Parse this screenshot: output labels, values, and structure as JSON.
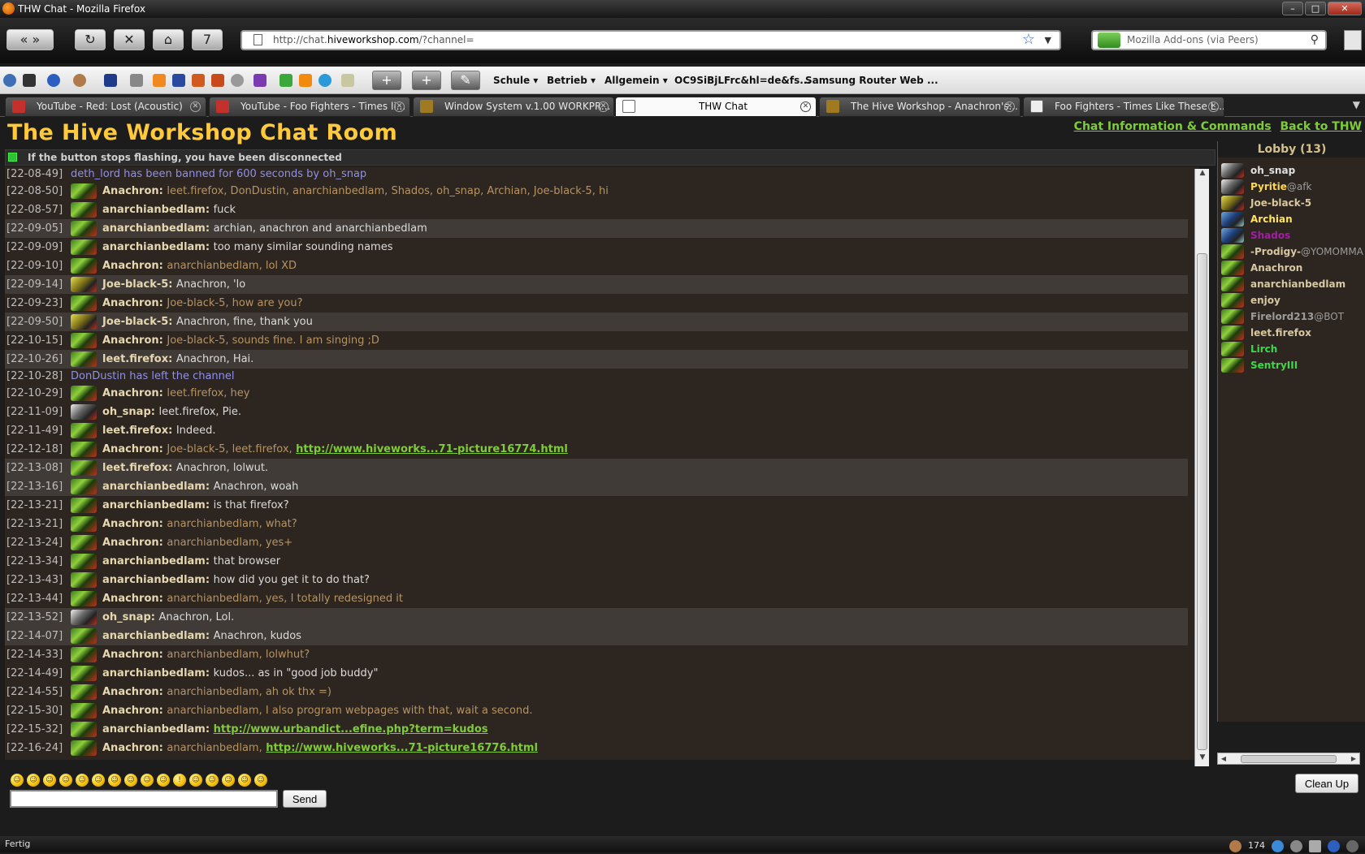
{
  "window": {
    "title": "THW Chat - Mozilla Firefox"
  },
  "nav": {
    "url_prefix": "http://chat.",
    "url_domain": "hiveworkshop.com",
    "url_suffix": "/?channel=",
    "search_placeholder": "Mozilla Add-ons (via Peers)",
    "history_count": "7"
  },
  "bookmarks": {
    "folders": [
      "Schule",
      "Betrieb",
      "Allgemein"
    ],
    "links": [
      "OC9SiBjLFrc&hl=de&fs...",
      "Samsung Router Web ..."
    ]
  },
  "tabs": [
    {
      "label": "YouTube - Red: Lost (Acoustic)",
      "icon": "youtube-icon"
    },
    {
      "label": "YouTube - Foo Fighters - Times li...",
      "icon": "youtube-icon"
    },
    {
      "label": "Window System v.1.00 WORKPR...",
      "icon": "hive-icon"
    },
    {
      "label": "THW Chat",
      "icon": "page-icon"
    },
    {
      "label": "The Hive Workshop - Anachron's...",
      "icon": "hive-icon"
    },
    {
      "label": "Foo Fighters - Times Like These L...",
      "icon": "page-icon"
    }
  ],
  "page": {
    "title": "The Hive Workshop Chat Room",
    "link_info": "Chat Information & Commands",
    "link_back": "Back to THW",
    "status_notice": "If the button stops flashing, you have been disconnected"
  },
  "messages": [
    {
      "ts": "[22-08-49]",
      "system": "deth_lord has been banned for 600 seconds by oh_snap"
    },
    {
      "ts": "[22-08-50]",
      "nick": "Anachron:",
      "text": "leet.firefox, DonDustin, anarchianbedlam, Shados, oh_snap, Archian, Joe-black-5, hi"
    },
    {
      "ts": "[22-08-57]",
      "nick": "anarchianbedlam:",
      "text": "fuck"
    },
    {
      "ts": "[22-09-05]",
      "nick": "anarchianbedlam:",
      "text": "archian, anachron and anarchianbedlam"
    },
    {
      "ts": "[22-09-09]",
      "nick": "anarchianbedlam:",
      "text": "too many similar sounding names"
    },
    {
      "ts": "[22-09-10]",
      "nick": "Anachron:",
      "text": "anarchianbedlam, lol XD"
    },
    {
      "ts": "[22-09-14]",
      "nick": "Joe-black-5:",
      "text": "Anachron, 'lo"
    },
    {
      "ts": "[22-09-23]",
      "nick": "Anachron:",
      "text": "Joe-black-5, how are you?"
    },
    {
      "ts": "[22-09-50]",
      "nick": "Joe-black-5:",
      "text": "Anachron, fine, thank you"
    },
    {
      "ts": "[22-10-15]",
      "nick": "Anachron:",
      "text": "Joe-black-5, sounds fine. I am singing ;D"
    },
    {
      "ts": "[22-10-26]",
      "nick": "leet.firefox:",
      "text": "Anachron, Hai."
    },
    {
      "ts": "[22-10-28]",
      "system": "DonDustin has left the channel"
    },
    {
      "ts": "[22-10-29]",
      "nick": "Anachron:",
      "text": "leet.firefox, hey"
    },
    {
      "ts": "[22-11-09]",
      "nick": "oh_snap:",
      "text": "leet.firefox, Pie."
    },
    {
      "ts": "[22-11-49]",
      "nick": "leet.firefox:",
      "text": "Indeed."
    },
    {
      "ts": "[22-12-18]",
      "nick": "Anachron:",
      "text": "Joe-black-5, leet.firefox,",
      "link": "http://www.hiveworks...71-picture16774.html"
    },
    {
      "ts": "[22-13-08]",
      "nick": "leet.firefox:",
      "text": "Anachron, lolwut."
    },
    {
      "ts": "[22-13-16]",
      "nick": "anarchianbedlam:",
      "text": "Anachron, woah"
    },
    {
      "ts": "[22-13-21]",
      "nick": "anarchianbedlam:",
      "text": "is that firefox?"
    },
    {
      "ts": "[22-13-21]",
      "nick": "Anachron:",
      "text": "anarchianbedlam, what?"
    },
    {
      "ts": "[22-13-24]",
      "nick": "Anachron:",
      "text": "anarchianbedlam, yes+"
    },
    {
      "ts": "[22-13-34]",
      "nick": "anarchianbedlam:",
      "text": "that browser"
    },
    {
      "ts": "[22-13-43]",
      "nick": "anarchianbedlam:",
      "text": "how did you get it to do that?"
    },
    {
      "ts": "[22-13-44]",
      "nick": "Anachron:",
      "text": "anarchianbedlam, yes, I totally redesigned it"
    },
    {
      "ts": "[22-13-52]",
      "nick": "oh_snap:",
      "text": "Anachron, Lol."
    },
    {
      "ts": "[22-14-07]",
      "nick": "anarchianbedlam:",
      "text": "Anachron, kudos"
    },
    {
      "ts": "[22-14-33]",
      "nick": "Anachron:",
      "text": "anarchianbedlam, lolwhut?"
    },
    {
      "ts": "[22-14-49]",
      "nick": "anarchianbedlam:",
      "text": "kudos... as in \"good job buddy\""
    },
    {
      "ts": "[22-14-55]",
      "nick": "Anachron:",
      "text": "anarchianbedlam, ah ok thx =)"
    },
    {
      "ts": "[22-15-30]",
      "nick": "Anachron:",
      "text": "anarchianbedlam, I also program webpages with that, wait a second."
    },
    {
      "ts": "[22-15-32]",
      "nick": "anarchianbedlam:",
      "text": "",
      "link": "http://www.urbandict...efine.php?term=kudos"
    },
    {
      "ts": "[22-16-24]",
      "nick": "Anachron:",
      "text": "anarchianbedlam,",
      "link": "http://www.hiveworks...71-picture16776.html"
    }
  ],
  "lobby": {
    "title": "Lobby (13)",
    "users": [
      {
        "name": "oh_snap",
        "suffix": "",
        "color": "#e0e0e0",
        "avatar": "bw"
      },
      {
        "name": "Pyritie",
        "suffix": "@afk",
        "color": "#ffd84a",
        "avatar": "bw"
      },
      {
        "name": "Joe-black-5",
        "suffix": "",
        "color": "#d8c8a0",
        "avatar": "yl"
      },
      {
        "name": "Archian",
        "suffix": "",
        "color": "#ffe45a",
        "avatar": "bl"
      },
      {
        "name": "Shados",
        "suffix": "",
        "color": "#a020a0",
        "avatar": "bl"
      },
      {
        "name": "-Prodigy-",
        "suffix": "@YOMOMMA",
        "color": "#d8c8a0",
        "avatar": "gr"
      },
      {
        "name": "Anachron",
        "suffix": "",
        "color": "#d8c8a0",
        "avatar": "gr"
      },
      {
        "name": "anarchianbedlam",
        "suffix": "",
        "color": "#d8c8a0",
        "avatar": "gr"
      },
      {
        "name": "enjoy",
        "suffix": "",
        "color": "#d8c8a0",
        "avatar": "gr"
      },
      {
        "name": "Firelord213",
        "suffix": "@BOT",
        "color": "#9c9c9c",
        "avatar": "gr"
      },
      {
        "name": "leet.firefox",
        "suffix": "",
        "color": "#d8c8a0",
        "avatar": "gr"
      },
      {
        "name": "Lirch",
        "suffix": "",
        "color": "#3ed84a",
        "avatar": "gr"
      },
      {
        "name": "SentryIII",
        "suffix": "",
        "color": "#3ed84a",
        "avatar": "gr"
      }
    ]
  },
  "input": {
    "send_label": "Send",
    "cleanup_label": "Clean Up"
  },
  "statusbar": {
    "text": "Fertig",
    "counter": "174"
  }
}
